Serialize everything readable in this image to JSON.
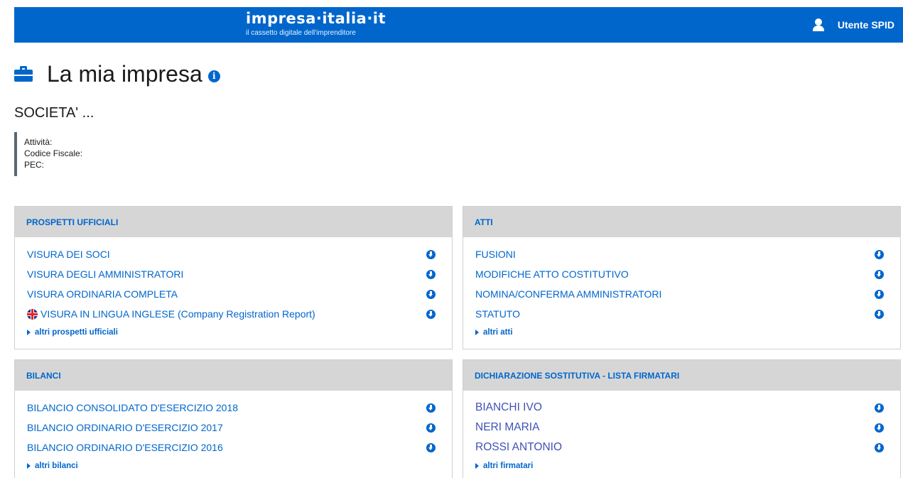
{
  "header": {
    "brand": "impresa·italia·it",
    "tagline": "il cassetto digitale dell'imprenditore",
    "user_label": "Utente SPID"
  },
  "page": {
    "title": "La mia impresa",
    "company_name": "SOCIETA' ...",
    "details": {
      "activity_label": "Attività:",
      "tax_code_label": "Codice Fiscale:",
      "pec_label": "PEC:"
    }
  },
  "panels": {
    "prospetti": {
      "title": "PROSPETTI UFFICIALI",
      "items": [
        "VISURA DEI SOCI",
        "VISURA DEGLI AMMINISTRATORI",
        "VISURA ORDINARIA COMPLETA",
        "VISURA IN LINGUA INGLESE (Company Registration Report)"
      ],
      "more": "altri prospetti ufficiali"
    },
    "atti": {
      "title": "ATTI",
      "items": [
        "FUSIONI",
        "MODIFICHE ATTO COSTITUTIVO",
        "NOMINA/CONFERMA AMMINISTRATORI",
        "STATUTO"
      ],
      "more": "altri atti"
    },
    "bilanci": {
      "title": "BILANCI",
      "items": [
        "BILANCIO CONSOLIDATO D'ESERCIZIO 2018",
        "BILANCIO ORDINARIO D'ESERCIZIO 2017",
        "BILANCIO ORDINARIO D'ESERCIZIO 2016"
      ],
      "more": "altri bilanci"
    },
    "firmatari": {
      "title": "DICHIARAZIONE SOSTITUTIVA - LISTA FIRMATARI",
      "items": [
        "BIANCHI IVO",
        "NERI MARIA",
        "ROSSI ANTONIO"
      ],
      "more": "altri firmatari"
    }
  },
  "colors": {
    "primary": "#0066cc",
    "panel_header": "#d6d6d6",
    "signer_text": "#3f51b5"
  },
  "icons": {
    "user": "user-icon",
    "title": "briefcase-icon",
    "info": "info-icon",
    "download": "download-icon",
    "more": "caret-right-icon",
    "english": "uk-flag-icon"
  }
}
